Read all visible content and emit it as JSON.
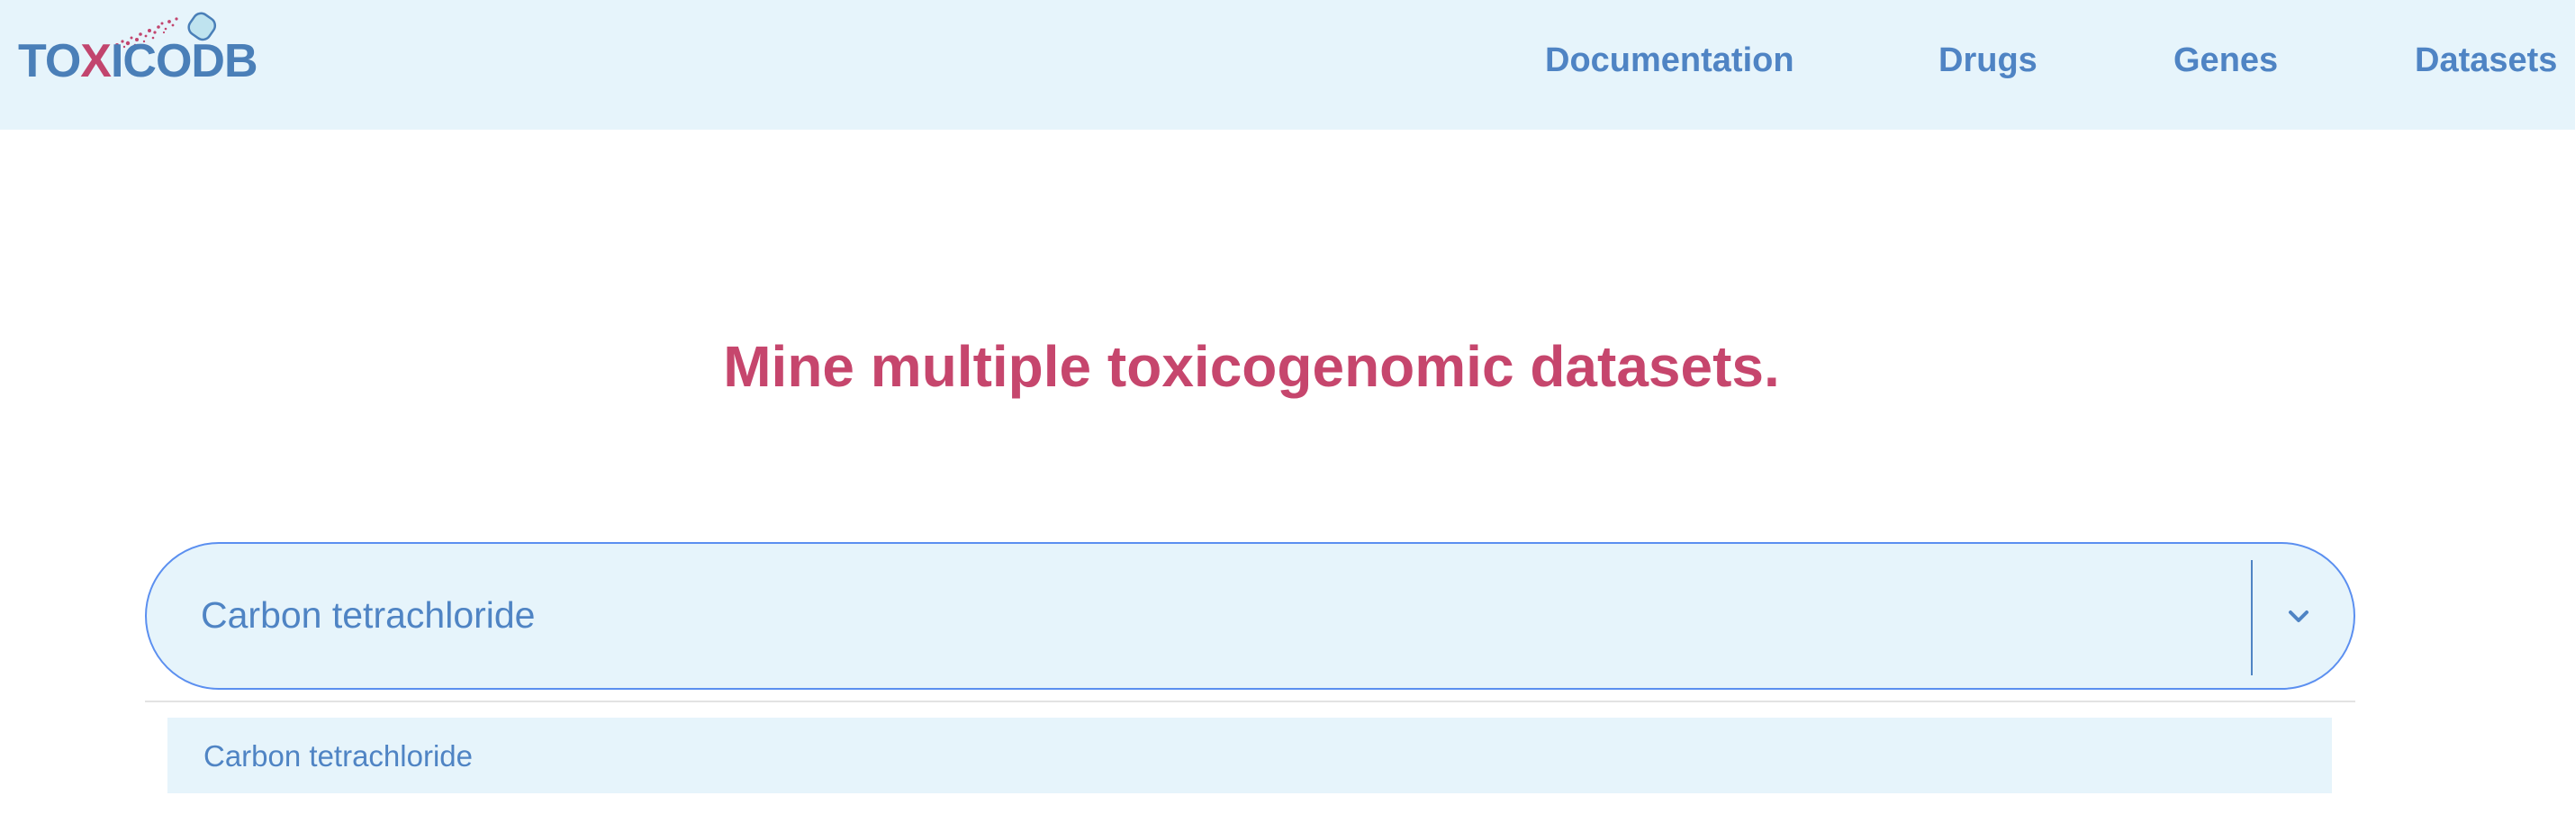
{
  "brand": {
    "logo_prefix": "TO",
    "logo_x": "X",
    "logo_suffix": "ICODB",
    "logo_alt": "TOXICODB",
    "colors": {
      "primary": "#4a7fb8",
      "accent": "#c2456e",
      "nav_bg": "#e6f4fb"
    }
  },
  "nav": {
    "items": [
      {
        "label": "Documentation"
      },
      {
        "label": "Drugs"
      },
      {
        "label": "Genes"
      },
      {
        "label": "Datasets"
      }
    ]
  },
  "hero": {
    "headline": "Mine multiple toxicogenomic datasets."
  },
  "search": {
    "value": "Carbon tetrachloride",
    "dropdown_icon": "chevron-down-icon",
    "options": [
      {
        "label": "Carbon tetrachloride"
      }
    ]
  }
}
